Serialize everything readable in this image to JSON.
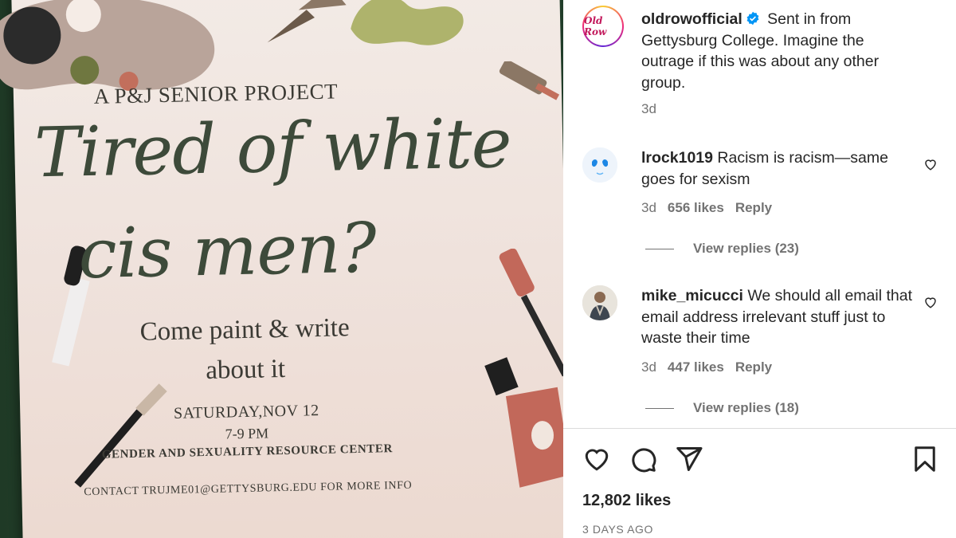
{
  "post_image": {
    "poster": {
      "subtitle": "A P&J SENIOR PROJECT",
      "title_line1": "Tired of white",
      "title_line2": "cis men?",
      "invite_line1": "Come paint & write",
      "invite_line2": "about it",
      "date": "SATURDAY,NOV 12",
      "time": "7-9 PM",
      "location": "GENDER AND SEXUALITY RESOURCE CENTER",
      "contact": "CONTACT TRUJME01@GETTYSBURG.EDU FOR MORE INFO"
    }
  },
  "caption": {
    "avatar_text": "Old Row",
    "username": "oldrowofficial",
    "verified_icon": "verified-badge-icon",
    "text": "Sent in from Gettysburg College. Imagine the outrage if this was about any other group.",
    "age": "3d"
  },
  "comments": [
    {
      "username": "lrock1019",
      "text": "Racism is racism—same goes for sexism",
      "age": "3d",
      "likes": "656 likes",
      "reply_label": "Reply",
      "view_replies": "View replies (23)"
    },
    {
      "username": "mike_micucci",
      "text": "We should all email that email address irrelevant stuff just to waste their time",
      "age": "3d",
      "likes": "447 likes",
      "reply_label": "Reply",
      "view_replies": "View replies (18)"
    }
  ],
  "actions": {
    "icons": [
      "heart-icon",
      "comment-icon",
      "share-icon",
      "bookmark-icon"
    ],
    "likes": "12,802 likes",
    "posted": "3 DAYS AGO"
  },
  "colors": {
    "text": "#262626",
    "secondary": "#737373",
    "verified": "#0095f6",
    "divider": "#dbdbdb"
  }
}
